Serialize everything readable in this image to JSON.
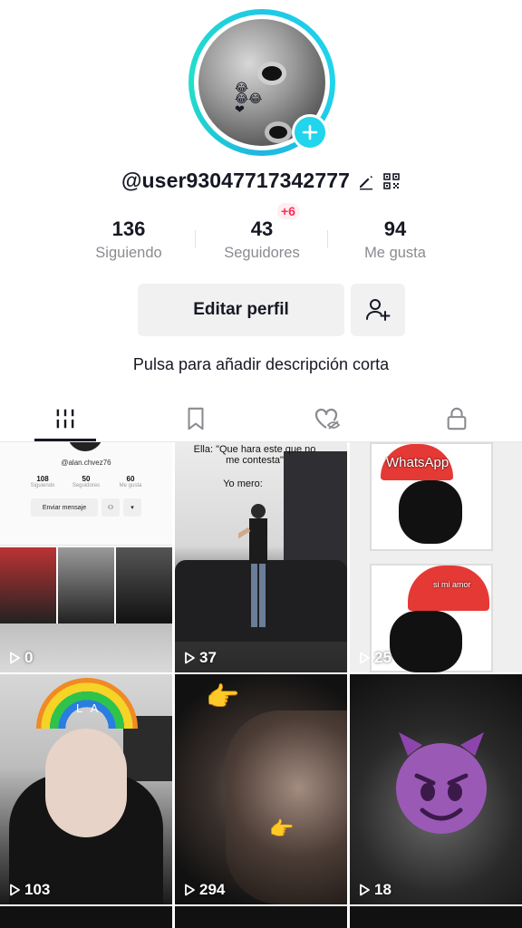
{
  "profile": {
    "username": "@user93047717342777",
    "bio_placeholder": "Pulsa para añadir descripción corta",
    "edit_button": "Editar perfil"
  },
  "stats": [
    {
      "value": "136",
      "label": "Siguiendo"
    },
    {
      "value": "43",
      "label": "Seguidores",
      "delta": "+6"
    },
    {
      "value": "94",
      "label": "Me gusta"
    }
  ],
  "tabs": [
    {
      "name": "videos",
      "icon": "grid-icon",
      "active": true
    },
    {
      "name": "favorites",
      "icon": "bookmark-icon"
    },
    {
      "name": "liked",
      "icon": "heart-hidden-icon"
    },
    {
      "name": "private",
      "icon": "lock-icon"
    }
  ],
  "videos": [
    {
      "views": "0",
      "mini": {
        "handle": "@alan.chvez76",
        "stats": [
          {
            "v": "108",
            "l": "Siguiendo"
          },
          {
            "v": "50",
            "l": "Seguidores"
          },
          {
            "v": "60",
            "l": "Me gusta"
          }
        ],
        "button": "Enviar mensaje"
      }
    },
    {
      "views": "37",
      "caption_top": "Ella: \"Que hara este que no me contesta\"",
      "caption_mid": "Yo mero:"
    },
    {
      "views": "25",
      "overlay_text": "WhatsApp",
      "overlay_text2": "si mi amor"
    },
    {
      "views": "103",
      "overlay_text": "L A"
    },
    {
      "views": "294"
    },
    {
      "views": "18"
    }
  ],
  "colors": {
    "accent": "#20d5ec",
    "red": "#fe2c55",
    "text": "#161823",
    "secondary": "#8a8b91"
  }
}
